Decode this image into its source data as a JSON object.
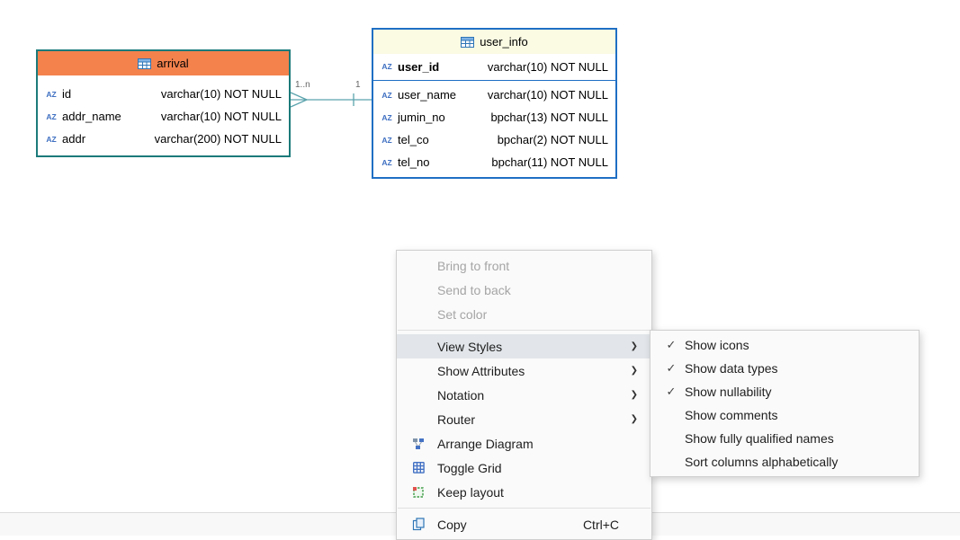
{
  "icons": {
    "column": "AZ",
    "check": "✓",
    "arrow": "❯"
  },
  "colors": {
    "arrival_header": "#F4824D",
    "arrival_border": "#1C7A7A",
    "userinfo_header": "#FBFBE3",
    "userinfo_border": "#1F6FC4",
    "relationship_line": "#5BA3AD",
    "menu_highlight": "#E2E6EA"
  },
  "entities": [
    {
      "name": "arrival",
      "columns": [
        {
          "name": "id",
          "type": "varchar(10) NOT NULL"
        },
        {
          "name": "addr_name",
          "type": "varchar(10) NOT NULL"
        },
        {
          "name": "addr",
          "type": "varchar(200) NOT NULL"
        }
      ]
    },
    {
      "name": "user_info",
      "columns": [
        {
          "name": "user_id",
          "type": "varchar(10) NOT NULL"
        },
        {
          "name": "user_name",
          "type": "varchar(10) NOT NULL"
        },
        {
          "name": "jumin_no",
          "type": "bpchar(13) NOT NULL"
        },
        {
          "name": "tel_co",
          "type": "bpchar(2) NOT NULL"
        },
        {
          "name": "tel_no",
          "type": "bpchar(11) NOT NULL"
        }
      ]
    }
  ],
  "relationship": {
    "from_label": "1..n",
    "to_label": "1"
  },
  "context_menu": {
    "items": [
      {
        "label": "Bring to front"
      },
      {
        "label": "Send to back"
      },
      {
        "label": "Set color"
      },
      {
        "label": "View Styles"
      },
      {
        "label": "Show Attributes"
      },
      {
        "label": "Notation"
      },
      {
        "label": "Router"
      },
      {
        "label": "Arrange Diagram"
      },
      {
        "label": "Toggle Grid"
      },
      {
        "label": "Keep layout"
      },
      {
        "label": "Copy",
        "shortcut": "Ctrl+C"
      }
    ]
  },
  "submenu": {
    "items": [
      {
        "label": "Show icons",
        "check": "✓"
      },
      {
        "label": "Show data types",
        "check": "✓"
      },
      {
        "label": "Show nullability",
        "check": "✓"
      },
      {
        "label": "Show comments",
        "check": ""
      },
      {
        "label": "Show fully qualified names",
        "check": ""
      },
      {
        "label": "Sort columns alphabetically",
        "check": ""
      }
    ]
  }
}
